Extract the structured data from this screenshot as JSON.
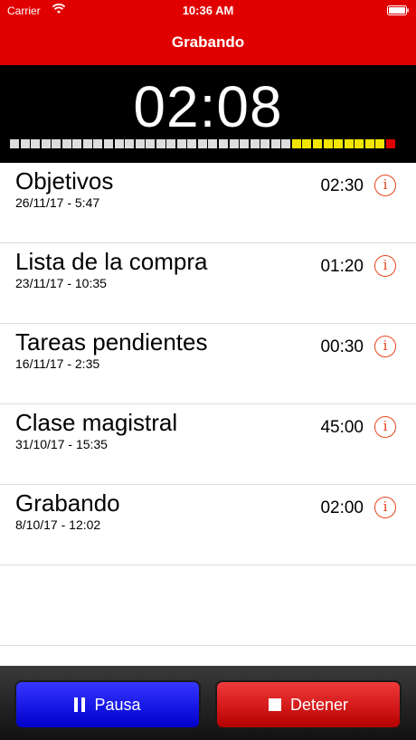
{
  "status": {
    "carrier": "Carrier",
    "time": "10:36 AM"
  },
  "nav": {
    "title": "Grabando"
  },
  "meter": {
    "timer": "02:08",
    "segments_total": 37,
    "segments_lit": 37,
    "colors": {
      "normal": "#dddddd",
      "warn": "#f2e600",
      "peak": "#e00000"
    },
    "warn_count": 9,
    "peak_count": 1
  },
  "recordings": [
    {
      "title": "Objetivos",
      "date": "26/11/17 - 5:47",
      "duration": "02:30"
    },
    {
      "title": "Lista de la compra",
      "date": "23/11/17 - 10:35",
      "duration": "01:20"
    },
    {
      "title": "Tareas pendientes",
      "date": "16/11/17 - 2:35",
      "duration": "00:30"
    },
    {
      "title": "Clase magistral",
      "date": "31/10/17 - 15:35",
      "duration": "45:00"
    },
    {
      "title": "Grabando",
      "date": "8/10/17 - 12:02",
      "duration": "02:00"
    }
  ],
  "info_glyph": "i",
  "toolbar": {
    "pause_label": "Pausa",
    "stop_label": "Detener"
  },
  "accent": {
    "bar": "#e00000",
    "info": "#e8441c",
    "pause": "#1a1ae8",
    "stop": "#d71c1c"
  }
}
